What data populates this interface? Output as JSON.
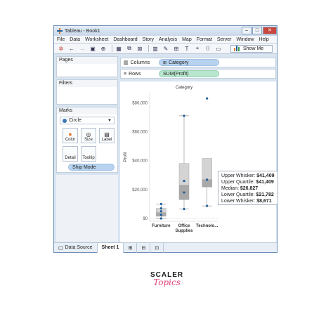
{
  "window": {
    "title": "Tableau - Book1"
  },
  "menu": [
    "File",
    "Data",
    "Worksheet",
    "Dashboard",
    "Story",
    "Analysis",
    "Map",
    "Format",
    "Server",
    "Window",
    "Help"
  ],
  "toolbar": {
    "show_me_label": "Show Me"
  },
  "left_panels": {
    "pages_label": "Pages",
    "filters_label": "Filters",
    "marks_label": "Marks",
    "mark_type": "Circle",
    "mark_buttons": [
      "Color",
      "Size",
      "Label",
      "Detail",
      "Tooltip"
    ],
    "marks_pill": "Ship Mode"
  },
  "shelves": {
    "columns_label": "Columns",
    "columns_pill": "Category",
    "rows_label": "Rows",
    "rows_pill": "SUM(Profit)"
  },
  "bottom_bar": {
    "data_source_label": "Data Source",
    "sheet_label": "Sheet 1"
  },
  "tooltip": {
    "rows": [
      {
        "label": "Upper Whisker:",
        "value": "$41,409"
      },
      {
        "label": "Upper Quartile:",
        "value": "$41,409"
      },
      {
        "label": "Median:",
        "value": "$26,827"
      },
      {
        "label": "Lower Quartile:",
        "value": "$21,782"
      },
      {
        "label": "Lower Whisker:",
        "value": "$8,671"
      }
    ]
  },
  "branding": {
    "line1": "SCALER",
    "line2": "Topics"
  },
  "chart_data": {
    "type": "box",
    "title": "Category",
    "ylabel": "Profit",
    "ylim": [
      0,
      85000
    ],
    "y_ticks": [
      "$0",
      "$20,000",
      "$40,000",
      "$60,000",
      "$80,000"
    ],
    "y_tick_values": [
      0,
      20000,
      40000,
      60000,
      80000
    ],
    "categories": [
      "Furniture",
      "Office Supplies",
      "Technology"
    ],
    "category_tick_labels": [
      "Furniture",
      "Office\nSupplies",
      "Technolo..."
    ],
    "boxes": [
      {
        "name": "Furniture",
        "whisker_low": 0,
        "q1": 1500,
        "median": 4000,
        "q3": 7000,
        "whisker_high": 10000,
        "points": [
          0,
          2500,
          5000,
          7000,
          10000
        ]
      },
      {
        "name": "Office Supplies",
        "whisker_low": 6500,
        "q1": 13000,
        "median": 23000,
        "q3": 38000,
        "whisker_high": 71000,
        "points": [
          6500,
          18000,
          26000,
          71000
        ]
      },
      {
        "name": "Technology",
        "whisker_low": 8671,
        "q1": 21782,
        "median": 26827,
        "q3": 41409,
        "whisker_high": 41409,
        "points": [
          8671,
          26827,
          83000
        ]
      }
    ],
    "colors": {
      "point": "#1f5f99",
      "highlight": "#2e9fd3",
      "box": "#d4d4d4",
      "box_dark": "#a9a9a9"
    }
  }
}
